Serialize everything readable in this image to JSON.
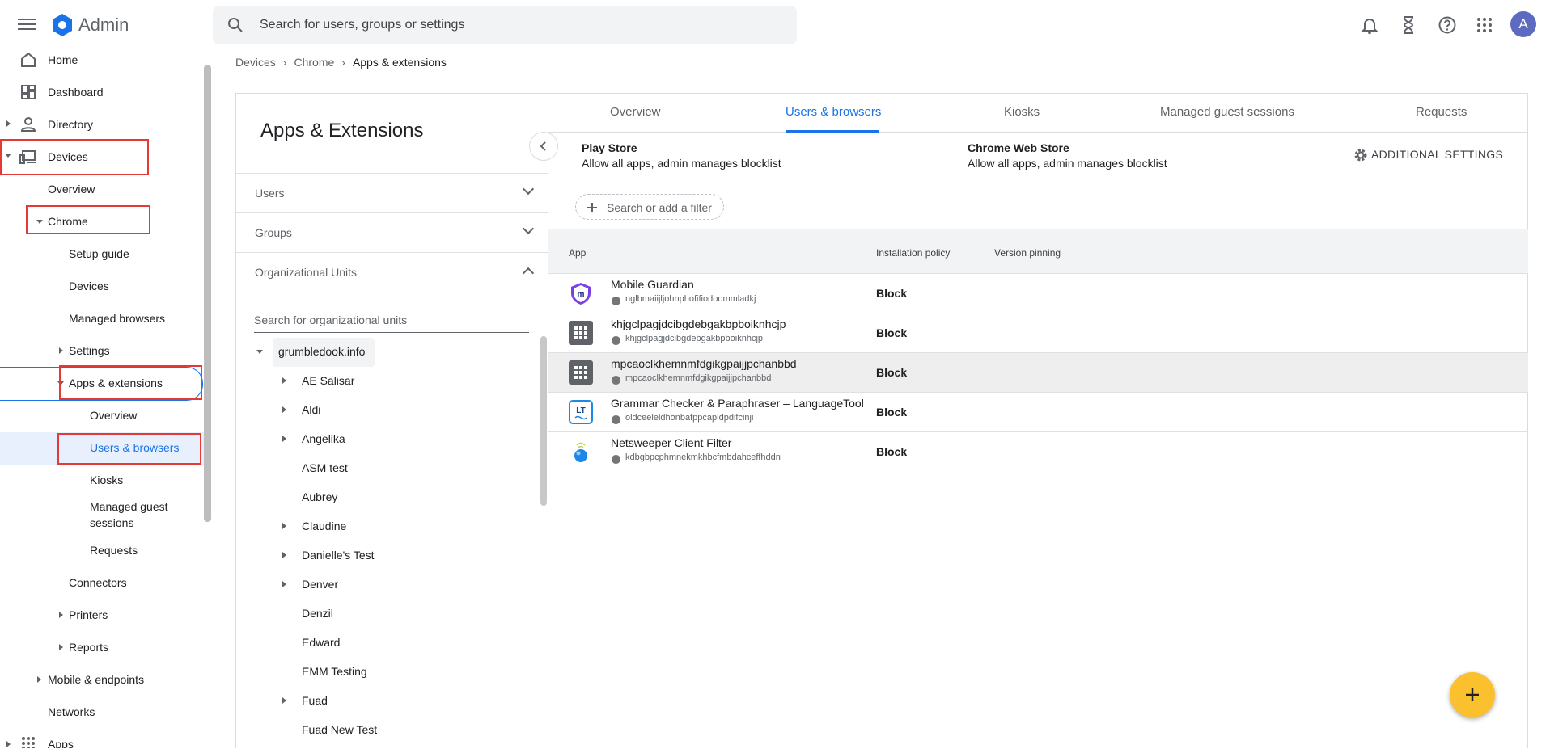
{
  "app": {
    "title": "Admin"
  },
  "search": {
    "placeholder": "Search for users, groups or settings"
  },
  "user": {
    "avatar_letter": "A"
  },
  "sidebar": {
    "home": "Home",
    "dashboard": "Dashboard",
    "directory": "Directory",
    "devices": "Devices",
    "overview": "Overview",
    "chrome": "Chrome",
    "setup_guide": "Setup guide",
    "chrome_devices": "Devices",
    "managed_browsers": "Managed browsers",
    "settings": "Settings",
    "apps_extensions": "Apps & extensions",
    "ae_overview": "Overview",
    "users_browsers": "Users & browsers",
    "kiosks": "Kiosks",
    "managed_guest_1": "Managed guest",
    "managed_guest_2": "sessions",
    "requests": "Requests",
    "connectors": "Connectors",
    "printers": "Printers",
    "reports": "Reports",
    "mobile_endpoints": "Mobile & endpoints",
    "networks": "Networks",
    "apps": "Apps"
  },
  "breadcrumb": {
    "item1": "Devices",
    "item2": "Chrome",
    "item3": "Apps & extensions"
  },
  "left_panel": {
    "title": "Apps & Extensions",
    "users": "Users",
    "groups": "Groups",
    "org_units": "Organizational Units",
    "ou_search_placeholder": "Search for organizational units",
    "root_ou": "grumbledook.info",
    "ous": [
      "AE Salisar",
      "Aldi",
      "Angelika",
      "ASM test",
      "Aubrey",
      "Claudine",
      "Danielle's Test",
      "Denver",
      "Denzil",
      "Edward",
      "EMM Testing",
      "Fuad",
      "Fuad New Test"
    ]
  },
  "tabs": [
    "Overview",
    "Users & browsers",
    "Kiosks",
    "Managed guest sessions",
    "Requests"
  ],
  "stores": {
    "play_title": "Play Store",
    "play_sub": "Allow all apps, admin manages blocklist",
    "cws_title": "Chrome Web Store",
    "cws_sub": "Allow all apps, admin manages blocklist",
    "additional_settings": "ADDITIONAL SETTINGS"
  },
  "filter": {
    "label": "Search or add a filter"
  },
  "table": {
    "headers": {
      "app": "App",
      "policy": "Installation policy",
      "pinning": "Version pinning"
    },
    "rows": [
      {
        "name": "Mobile Guardian",
        "id": "nglbmaiijljohnphofifiodoommladkj",
        "policy": "Block"
      },
      {
        "name": "khjgclpagjdcibgdebgakbpboiknhcjp",
        "id": "khjgclpagjdcibgdebgakbpboiknhcjp",
        "policy": "Block"
      },
      {
        "name": "mpcaoclkhemnmfdgikgpaijjpchanbbd",
        "id": "mpcaoclkhemnmfdgikgpaijjpchanbbd",
        "policy": "Block"
      },
      {
        "name": "Grammar Checker & Paraphraser – LanguageTool",
        "id": "oldceeleldhonbafppcapldpdifcinji",
        "policy": "Block"
      },
      {
        "name": "Netsweeper Client Filter",
        "id": "kdbgbpcphmnekmkhbcfmbdahceffhddn",
        "policy": "Block"
      }
    ]
  },
  "colors": {
    "accent": "#1a73e8",
    "highlight": "#e53935",
    "fab": "#fbc02d"
  }
}
